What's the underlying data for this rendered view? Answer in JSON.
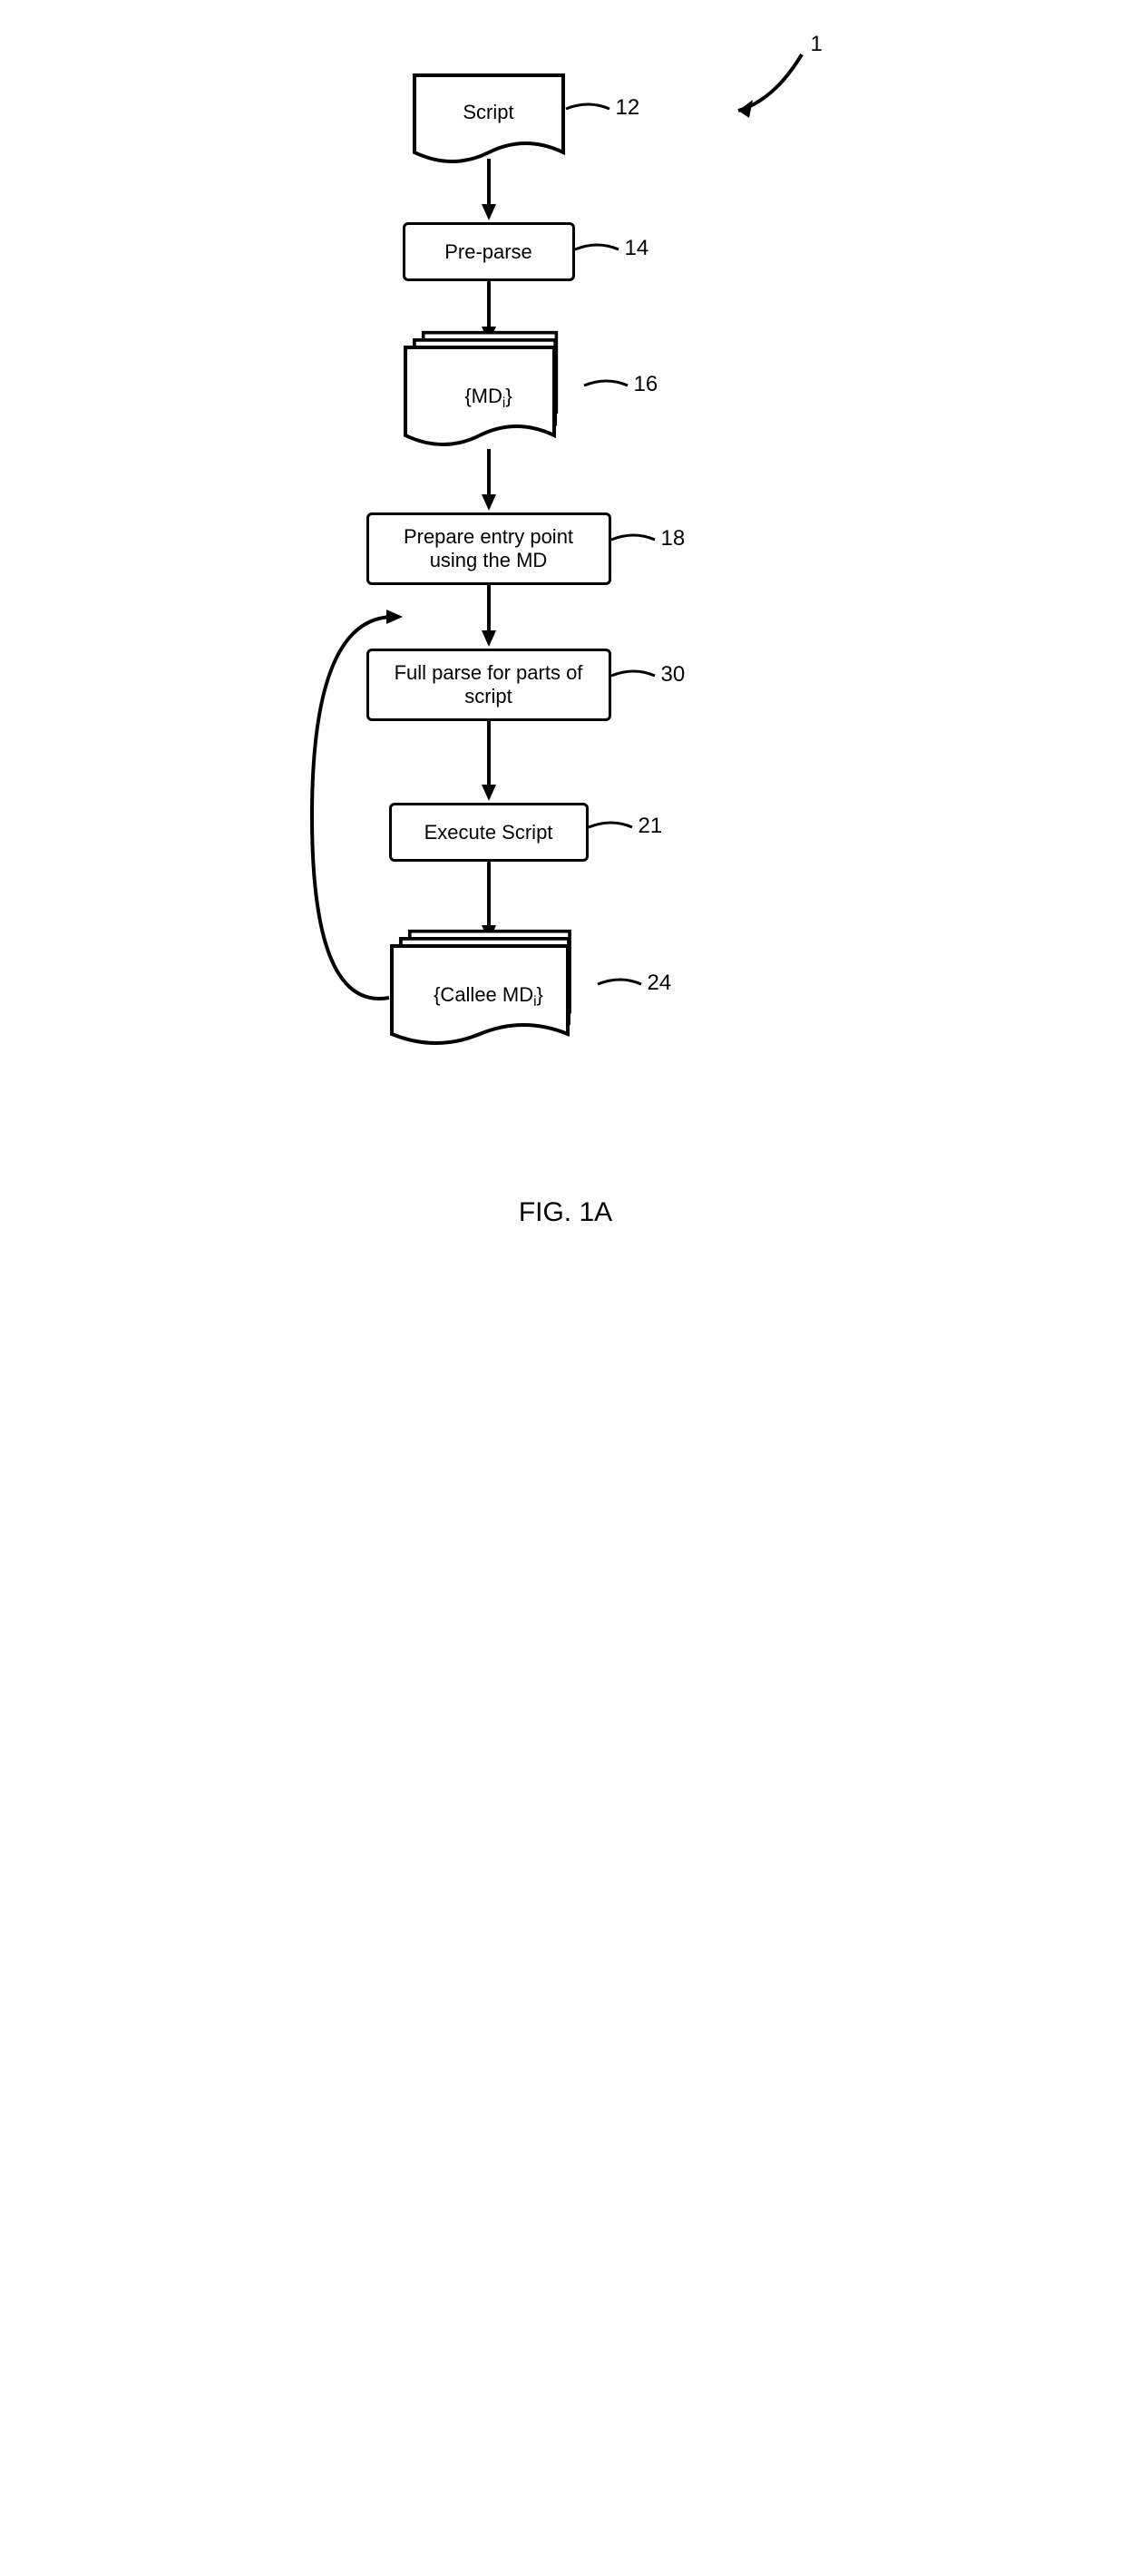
{
  "figure": {
    "caption": "FIG. 1A",
    "figureNumber": "1"
  },
  "nodes": {
    "script": {
      "label": "Script",
      "ref": "12"
    },
    "preparse": {
      "label": "Pre-parse",
      "ref": "14"
    },
    "md": {
      "label_pre": "{MD",
      "label_sub": "i",
      "label_post": "}",
      "ref": "16"
    },
    "prepEntry": {
      "label": "Prepare entry point using the MD",
      "ref": "18"
    },
    "fullParse": {
      "label": "Full parse for parts of script",
      "ref": "30"
    },
    "execute": {
      "label": "Execute Script",
      "ref": "21"
    },
    "callee": {
      "label_pre": "{Callee MD",
      "label_sub": "i",
      "label_post": "}",
      "ref": "24"
    }
  },
  "chart_data": {
    "type": "flowchart",
    "title": "FIG. 1A",
    "nodes": [
      {
        "id": "12",
        "label": "Script",
        "shape": "document"
      },
      {
        "id": "14",
        "label": "Pre-parse",
        "shape": "process"
      },
      {
        "id": "16",
        "label": "{MD_i}",
        "shape": "multi-document"
      },
      {
        "id": "18",
        "label": "Prepare entry point using the MD",
        "shape": "process"
      },
      {
        "id": "30",
        "label": "Full parse for parts of script",
        "shape": "process"
      },
      {
        "id": "21",
        "label": "Execute Script",
        "shape": "process"
      },
      {
        "id": "24",
        "label": "{Callee MD_i}",
        "shape": "multi-document"
      }
    ],
    "edges": [
      {
        "from": "12",
        "to": "14"
      },
      {
        "from": "14",
        "to": "16"
      },
      {
        "from": "16",
        "to": "18"
      },
      {
        "from": "18",
        "to": "30"
      },
      {
        "from": "30",
        "to": "21"
      },
      {
        "from": "21",
        "to": "24"
      },
      {
        "from": "24",
        "to": "30",
        "type": "loop-back"
      }
    ],
    "annotations": [
      {
        "id": "1",
        "label": "1",
        "type": "figure-reference-arc"
      }
    ]
  }
}
